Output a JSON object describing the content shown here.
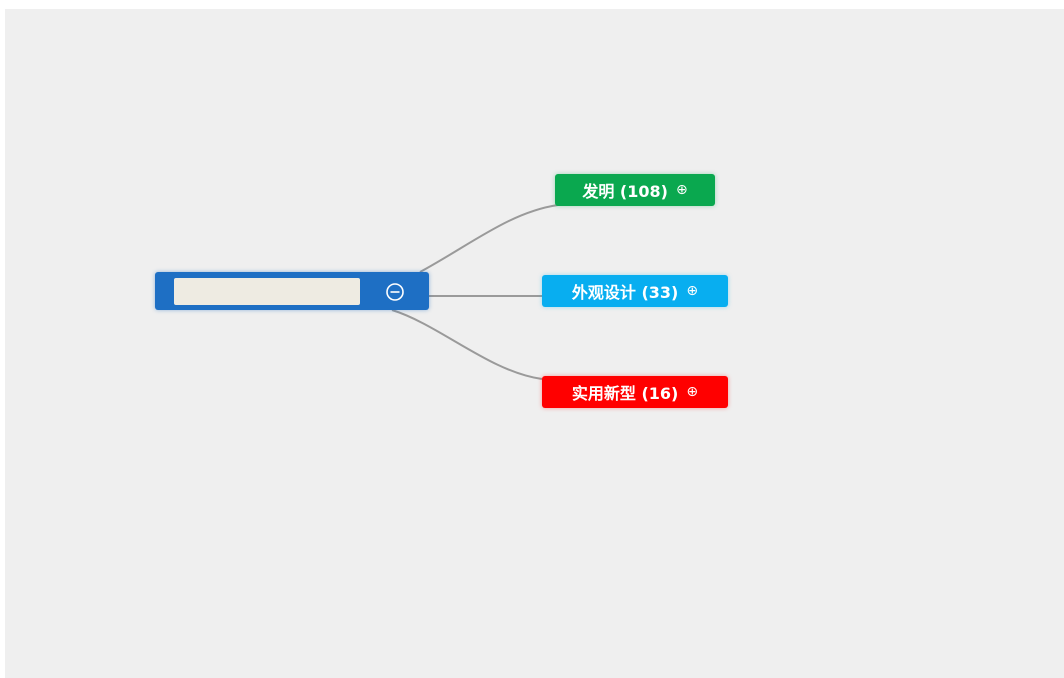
{
  "root": {
    "label": "",
    "toggle_icon": "collapse-minus-circle-icon",
    "color": "#1e6fc4"
  },
  "children": [
    {
      "label": "发明 (108)",
      "toggle": "⊕",
      "toggle_icon": "expand-plus-circle-icon",
      "color": "#0aa84f"
    },
    {
      "label": "外观设计 (33)",
      "toggle": "⊕",
      "toggle_icon": "expand-plus-circle-icon",
      "color": "#08aef0"
    },
    {
      "label": "实用新型 (16)",
      "toggle": "⊕",
      "toggle_icon": "expand-plus-circle-icon",
      "color": "#ff0000"
    }
  ],
  "link_color": "#9a9a9a",
  "background_color": "#efefef"
}
